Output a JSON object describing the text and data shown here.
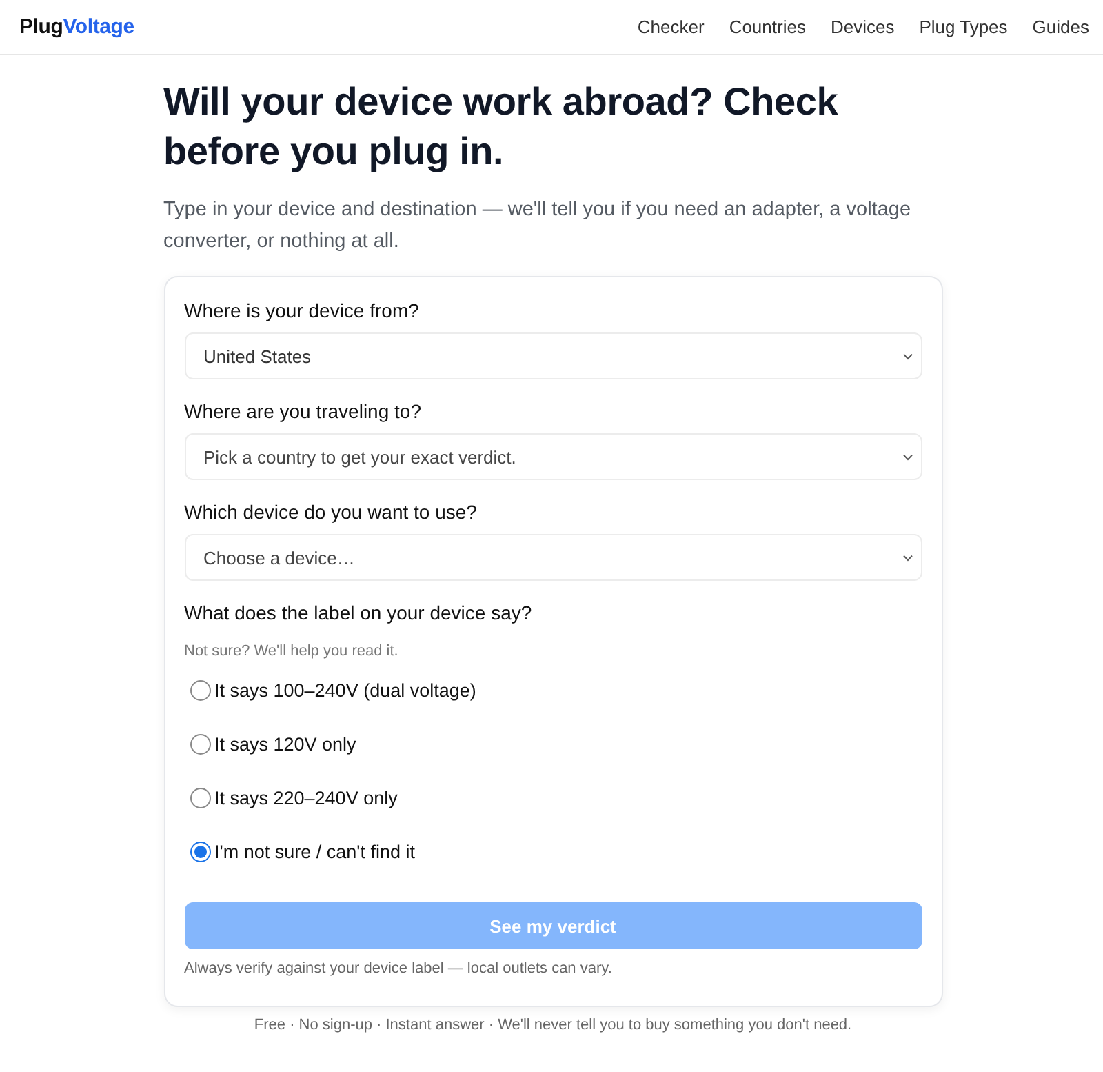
{
  "header": {
    "logo": {
      "part_1": "Plug",
      "part_2": "Voltage"
    },
    "nav": [
      {
        "label": "Checker"
      },
      {
        "label": "Countries"
      },
      {
        "label": "Devices"
      },
      {
        "label": "Plug Types"
      },
      {
        "label": "Guides"
      }
    ]
  },
  "hero": {
    "title": "Will your device work abroad? Check before you plug in.",
    "subtitle": "Type in your device and destination — we'll tell you if you need an adapter, a voltage converter, or nothing at all."
  },
  "form": {
    "fields": [
      {
        "label": "Where is your device from?",
        "value": "United States"
      },
      {
        "label": "Where are you traveling to?",
        "placeholder": "Pick a country to get your exact verdict."
      },
      {
        "label": "Which device do you want to use?",
        "placeholder": "Choose a device…"
      }
    ],
    "label_question": {
      "label": "What does the label on your device say?",
      "hint": "Not sure? We'll help you read it.",
      "options": [
        {
          "label": "It says 100–240V (dual voltage)",
          "selected": false
        },
        {
          "label": "It says 120V only",
          "selected": false
        },
        {
          "label": "It says 220–240V only",
          "selected": false
        },
        {
          "label": "I'm not sure / can't find it",
          "selected": true
        }
      ]
    },
    "submit": {
      "label": "See my verdict",
      "disabled": true
    },
    "note": "Always verify against your device label — local outlets can vary."
  },
  "footer": "Free · No sign-up · Instant answer · We'll never tell you to buy something you don't need."
}
